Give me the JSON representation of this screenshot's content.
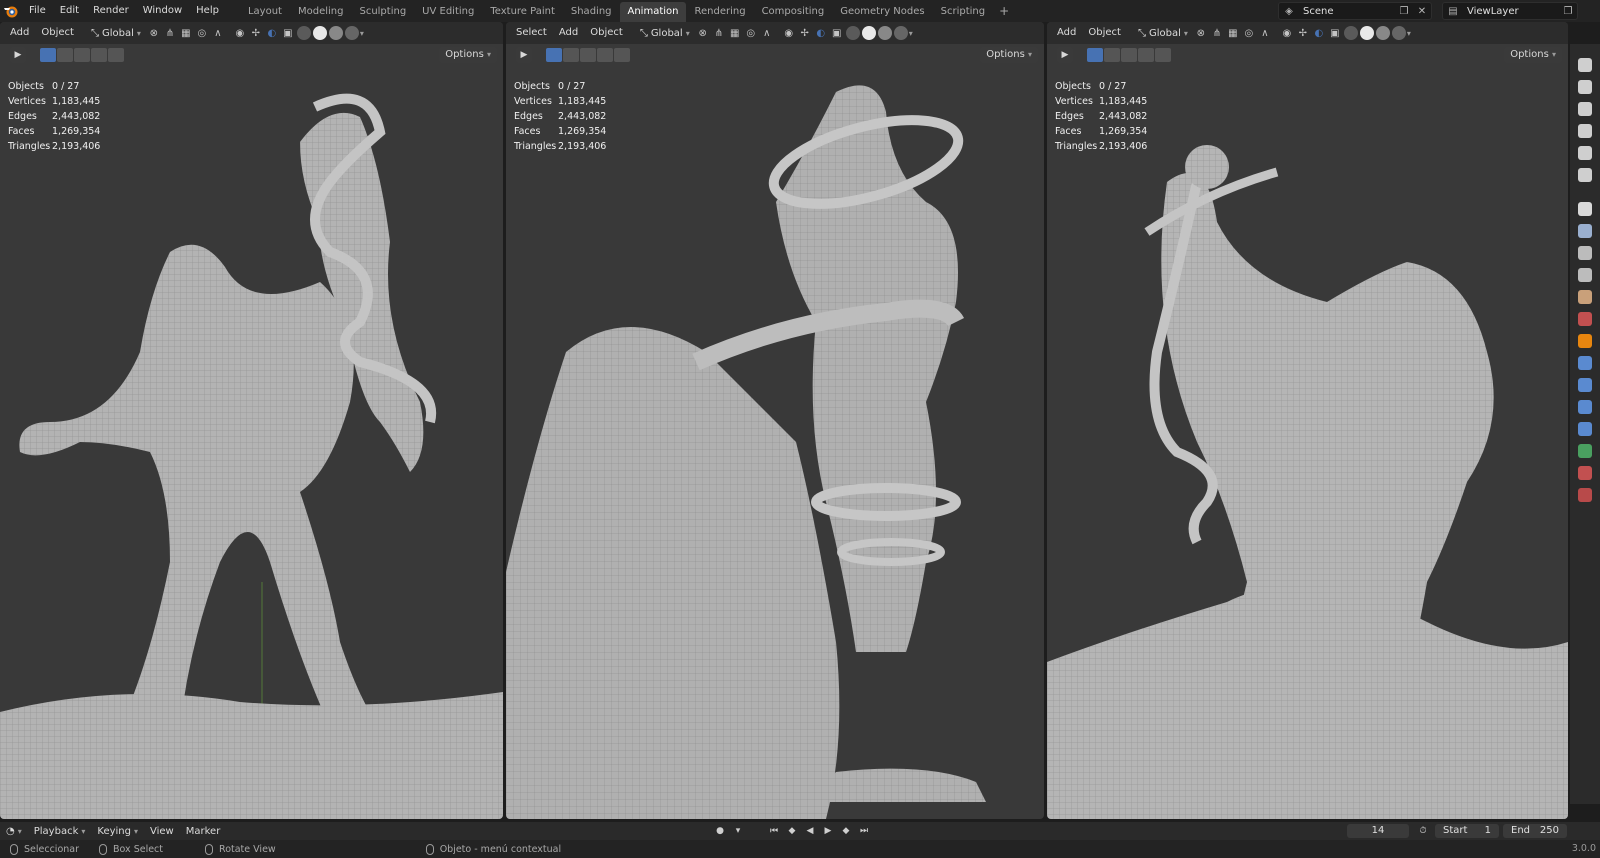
{
  "menu": {
    "file": "File",
    "edit": "Edit",
    "render": "Render",
    "window": "Window",
    "help": "Help"
  },
  "workspaces": [
    "Layout",
    "Modeling",
    "Sculpting",
    "UV Editing",
    "Texture Paint",
    "Shading",
    "Animation",
    "Rendering",
    "Compositing",
    "Geometry Nodes",
    "Scripting"
  ],
  "active_workspace": "Animation",
  "scene": {
    "label": "Scene",
    "view_layer": "ViewLayer"
  },
  "viewports": [
    {
      "menu": [
        "Add",
        "Object"
      ],
      "orientation": "Global",
      "options": "Options",
      "stats": {
        "objects_label": "Objects",
        "objects": "0 / 27",
        "vertices_label": "Vertices",
        "vertices": "1,183,445",
        "edges_label": "Edges",
        "edges": "2,443,082",
        "faces_label": "Faces",
        "faces": "1,269,354",
        "triangles_label": "Triangles",
        "triangles": "2,193,406"
      }
    },
    {
      "menu": [
        "Select",
        "Add",
        "Object"
      ],
      "orientation": "Global",
      "options": "Options",
      "stats": {
        "objects_label": "Objects",
        "objects": "0 / 27",
        "vertices_label": "Vertices",
        "vertices": "1,183,445",
        "edges_label": "Edges",
        "edges": "2,443,082",
        "faces_label": "Faces",
        "faces": "1,269,354",
        "triangles_label": "Triangles",
        "triangles": "2,193,406"
      }
    },
    {
      "menu": [
        "Add",
        "Object"
      ],
      "orientation": "Global",
      "options": "Options",
      "stats": {
        "objects_label": "Objects",
        "objects": "0 / 27",
        "vertices_label": "Vertices",
        "vertices": "1,183,445",
        "edges_label": "Edges",
        "edges": "2,443,082",
        "faces_label": "Faces",
        "faces": "1,269,354",
        "triangles_label": "Triangles",
        "triangles": "2,193,406"
      }
    }
  ],
  "timeline": {
    "playback": "Playback",
    "keying": "Keying",
    "view": "View",
    "marker": "Marker",
    "current_frame": "14",
    "start_label": "Start",
    "start": "1",
    "end_label": "End",
    "end": "250"
  },
  "status": {
    "select": "Seleccionar",
    "box_select": "Box Select",
    "rotate": "Rotate View",
    "context": "Objeto - menú contextual",
    "version": "3.0.0"
  },
  "colors": {
    "accent": "#4772b3",
    "viewport_bg": "#393939",
    "header_bg": "#2c2c2c",
    "mesh": "#b8b8b8"
  },
  "icons": [
    "blender-logo",
    "cursor-icon",
    "transform-icon",
    "snap-icon",
    "proportional-icon",
    "overlay-icon",
    "xray-icon",
    "shading-wire",
    "shading-solid",
    "shading-material",
    "shading-rendered"
  ]
}
